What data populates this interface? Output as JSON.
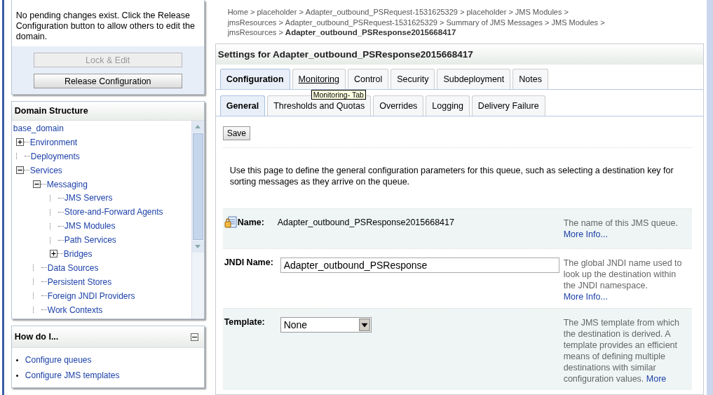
{
  "change_center": {
    "message": "No pending changes exist. Click the Release Configuration button to allow others to edit the domain.",
    "buttons": [
      {
        "label": "Lock & Edit",
        "disabled": true
      },
      {
        "label": "Release Configuration",
        "disabled": false
      }
    ]
  },
  "domain_structure": {
    "title": "Domain Structure",
    "tree": [
      {
        "label": "base_domain",
        "kind": "root",
        "children": [
          {
            "label": "Environment",
            "kind": "folder",
            "expanded": false
          },
          {
            "label": "Deployments",
            "kind": "leaf"
          },
          {
            "label": "Services",
            "kind": "folder",
            "expanded": true,
            "children": [
              {
                "label": "Messaging",
                "kind": "folder",
                "expanded": true,
                "children": [
                  {
                    "label": "JMS Servers",
                    "kind": "leaf"
                  },
                  {
                    "label": "Store-and-Forward Agents",
                    "kind": "leaf"
                  },
                  {
                    "label": "JMS Modules",
                    "kind": "leaf"
                  },
                  {
                    "label": "Path Services",
                    "kind": "leaf"
                  },
                  {
                    "label": "Bridges",
                    "kind": "folder",
                    "expanded": false
                  }
                ]
              },
              {
                "label": "Data Sources",
                "kind": "leaf"
              },
              {
                "label": "Persistent Stores",
                "kind": "leaf"
              },
              {
                "label": "Foreign JNDI Providers",
                "kind": "leaf"
              },
              {
                "label": "Work Contexts",
                "kind": "leaf"
              }
            ]
          }
        ]
      }
    ]
  },
  "how_do_i": {
    "title": "How do I...",
    "links": [
      "Configure queues",
      "Configure JMS templates"
    ]
  },
  "breadcrumb": {
    "items": [
      "Home >",
      "placeholder >",
      "Adapter_outbound_PSRequest-1531625329 >",
      "placeholder >",
      "JMS Modules >",
      "jmsResources >",
      "Adapter_outbound_PSRequest-1531625329 >",
      "Summary of JMS Messages >",
      "JMS Modules >",
      "jmsResources >"
    ],
    "current": "Adapter_outbound_PSResponse2015668417"
  },
  "settings": {
    "title": "Settings for Adapter_outbound_PSResponse2015668417",
    "tabs": [
      {
        "label": "Configuration",
        "selected": true,
        "hovered": false
      },
      {
        "label": "Monitoring",
        "selected": false,
        "hovered": true
      },
      {
        "label": "Control",
        "selected": false,
        "hovered": false
      },
      {
        "label": "Security",
        "selected": false,
        "hovered": false
      },
      {
        "label": "Subdeployment",
        "selected": false,
        "hovered": false
      },
      {
        "label": "Notes",
        "selected": false,
        "hovered": false
      }
    ],
    "tooltip": "Monitoring- Tab",
    "subtabs": [
      {
        "label": "General",
        "selected": true
      },
      {
        "label": "Thresholds and Quotas",
        "selected": false
      },
      {
        "label": "Overrides",
        "selected": false
      },
      {
        "label": "Logging",
        "selected": false
      },
      {
        "label": "Delivery Failure",
        "selected": false
      }
    ],
    "save_button": "Save",
    "description": "Use this page to define the general configuration parameters for this queue, such as selecting a destination key for sorting messages as they arrive on the queue.",
    "fields": [
      {
        "kind": "readonly",
        "label": "Name:",
        "value": "Adapter_outbound_PSResponse2015668417",
        "help": "The name of this JMS queue.",
        "link": "More Info..."
      },
      {
        "kind": "text",
        "label": "JNDI Name:",
        "value": "Adapter_outbound_PSResponse",
        "help": "The global JNDI name used to look up the destination within the JNDI namespace.",
        "link": "More Info..."
      },
      {
        "kind": "select",
        "label": "Template:",
        "value": "None",
        "help": "The JMS template from which the destination is derived. A template provides an efficient means of defining multiple destinations with similar configuration values.",
        "link": "More"
      }
    ]
  }
}
